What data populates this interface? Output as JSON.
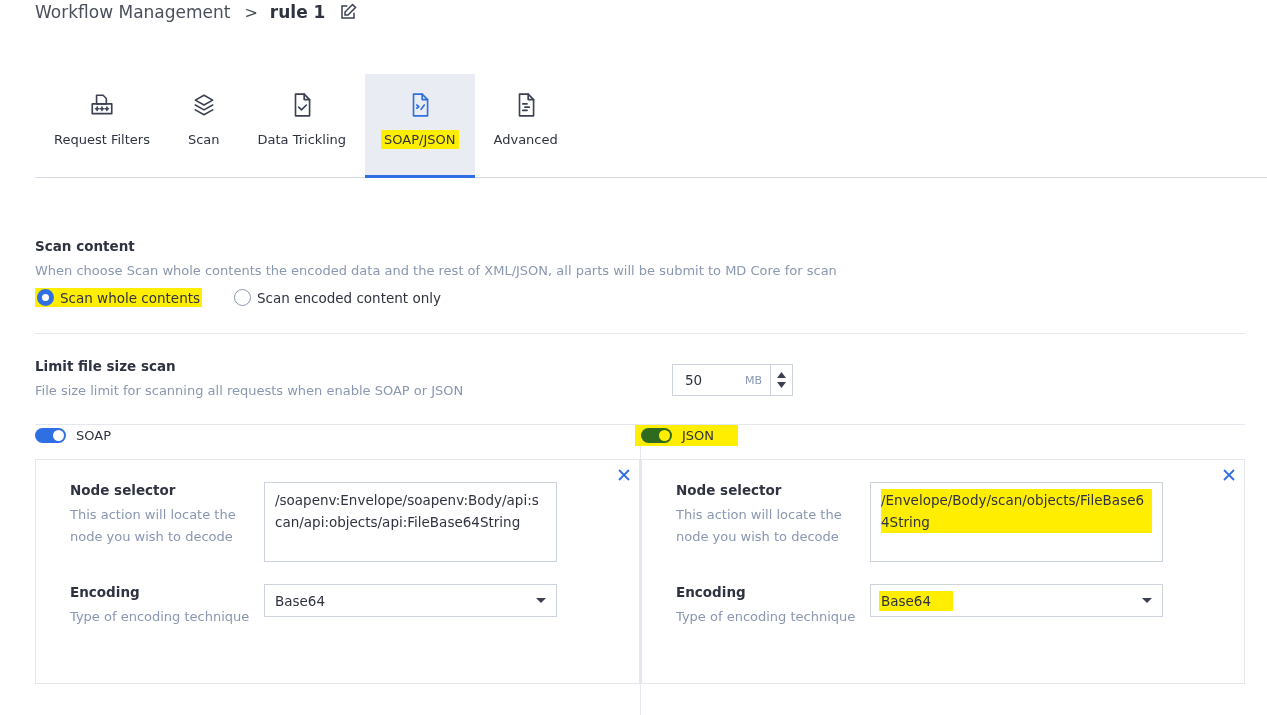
{
  "breadcrumb": {
    "parent": "Workflow Management",
    "separator": ">",
    "current": "rule 1"
  },
  "tabs": [
    {
      "label": "Request Filters",
      "kind": "filter",
      "selected": false,
      "highlighted": false
    },
    {
      "label": "Scan",
      "kind": "layers",
      "selected": false,
      "highlighted": false
    },
    {
      "label": "Data Trickling",
      "kind": "check",
      "selected": false,
      "highlighted": false
    },
    {
      "label": "SOAP/JSON",
      "kind": "code",
      "selected": true,
      "highlighted": true
    },
    {
      "label": "Advanced",
      "kind": "doc",
      "selected": false,
      "highlighted": false
    }
  ],
  "scan_content": {
    "title": "Scan content",
    "description": "When choose Scan whole contents the encoded data and the rest of XML/JSON, all parts will be submit to MD Core for scan",
    "options": [
      {
        "label": "Scan whole contents",
        "selected": true,
        "highlighted": true
      },
      {
        "label": "Scan encoded content only",
        "selected": false,
        "highlighted": false
      }
    ]
  },
  "limit": {
    "title": "Limit file size scan",
    "description": "File size limit for scanning all requests when enable SOAP or JSON",
    "value": "50",
    "unit": "MB"
  },
  "panels": [
    {
      "label": "SOAP",
      "on": true,
      "highlighted": false,
      "node_title": "Node selector",
      "node_description": "This action will locate the node you wish to decode",
      "node_value": "/soapenv:Envelope/soapenv:Body/api:scan/api:objects/api:FileBase64String",
      "node_highlighted": false,
      "encoding_title": "Encoding",
      "encoding_description": "Type of encoding technique",
      "encoding_value": "Base64",
      "encoding_highlighted": false
    },
    {
      "label": "JSON",
      "on": true,
      "highlighted": true,
      "node_title": "Node selector",
      "node_description": "This action will locate the node you wish to decode",
      "node_value": "/Envelope/Body/scan/objects/FileBase64String",
      "node_highlighted": true,
      "encoding_title": "Encoding",
      "encoding_description": "Type of encoding technique",
      "encoding_value": "Base64",
      "encoding_highlighted": true
    }
  ]
}
